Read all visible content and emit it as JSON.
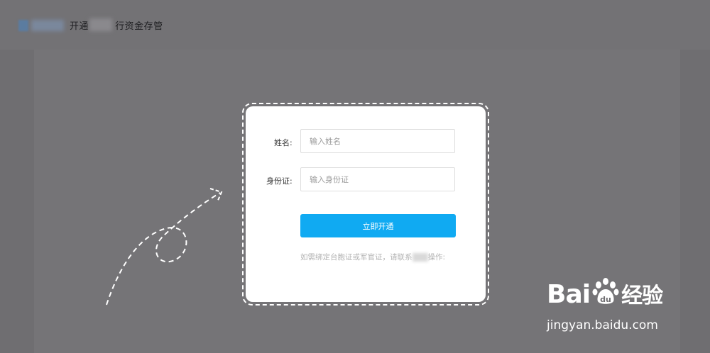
{
  "header": {
    "title_prefix": "开通",
    "title_suffix": "行资金存管"
  },
  "form": {
    "name_label": "姓名:",
    "name_placeholder": "输入姓名",
    "id_label": "身份证:",
    "id_placeholder": "输入身份证",
    "submit_label": "立即开通",
    "note_prefix": "如需绑定台胞证或军官证，请联系",
    "note_suffix": "操作:"
  },
  "watermark": {
    "brand_left": "Bai",
    "brand_right": "经验",
    "url": "jingyan.baidu.com"
  },
  "colors": {
    "overlay": "#6f6e71",
    "accent": "#10aaf2"
  }
}
